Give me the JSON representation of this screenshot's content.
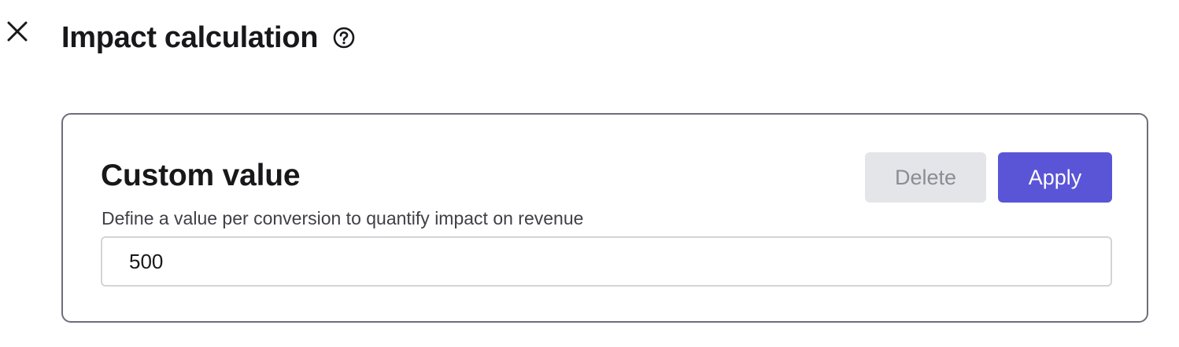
{
  "header": {
    "title": "Impact calculation",
    "close_icon": "close-icon",
    "help_icon": "question-circle-icon"
  },
  "card": {
    "title": "Custom value",
    "description": "Define a value per conversion to quantify impact on revenue",
    "delete_label": "Delete",
    "apply_label": "Apply",
    "value": "500"
  },
  "colors": {
    "accent": "#5a55d6",
    "disabled_bg": "#e4e5e8",
    "disabled_text": "#8a8d94",
    "card_border": "#6e6e7a"
  }
}
